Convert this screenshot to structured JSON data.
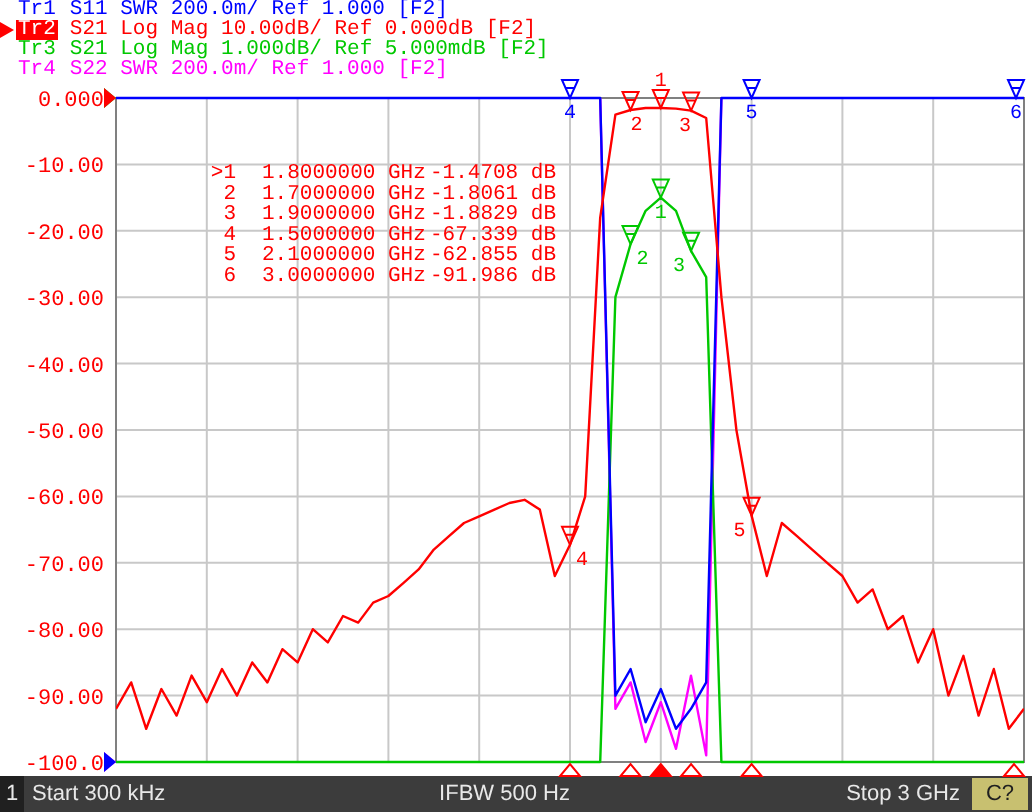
{
  "traces": [
    {
      "label": "Tr1",
      "kind": "swr",
      "markers": [
        {
          "shown": false
        },
        {
          "shown": false
        },
        {
          "shown": false
        },
        {
          "label": "4",
          "shown": true
        },
        {
          "label": "5",
          "shown": true
        },
        {
          "label": "6",
          "shown": true
        }
      ],
      "text": "S11 SWR 200.0m/ Ref 1.000 [F2]",
      "color": "#0000ff",
      "selected": false
    },
    {
      "label": "Tr2",
      "kind": "logmag",
      "markers": [
        {
          "label": "1",
          "shown": true
        },
        {
          "label": "2",
          "shown": true
        },
        {
          "label": "3",
          "shown": true
        },
        {
          "label": "4",
          "shown": true
        },
        {
          "label": "5",
          "shown": true
        },
        {
          "shown": false
        }
      ],
      "text": "S21 Log Mag 10.00dB/ Ref 0.000dB [F2]",
      "color": "#ff0000",
      "selected": true
    },
    {
      "label": "Tr3",
      "kind": "logmag",
      "markers": [
        {
          "label": "1",
          "shown": true
        },
        {
          "label": "2",
          "shown": true
        },
        {
          "label": "3",
          "shown": true
        }
      ],
      "text": "S21 Log Mag 1.000dB/ Ref 5.000mdB [F2]",
      "color": "#00c800",
      "selected": false
    },
    {
      "label": "Tr4",
      "kind": "swr",
      "text": "S22 SWR 200.0m/ Ref 1.000 [F2]",
      "color": "#ff00ff",
      "selected": false
    }
  ],
  "marker_table": [
    {
      "marker": ">1",
      "frequency": "1.8000000 GHz",
      "value": "-1.4708 dB",
      "selected": true
    },
    {
      "marker": "2",
      "frequency": "1.7000000 GHz",
      "value": "-1.8061 dB",
      "selected": false
    },
    {
      "marker": "3",
      "frequency": "1.9000000 GHz",
      "value": "-1.8829 dB",
      "selected": false
    },
    {
      "marker": "4",
      "frequency": "1.5000000 GHz",
      "value": "-67.339 dB",
      "selected": false
    },
    {
      "marker": "5",
      "frequency": "2.1000000 GHz",
      "value": "-62.855 dB",
      "selected": false
    },
    {
      "marker": "6",
      "frequency": "3.0000000 GHz",
      "value": "-91.986 dB",
      "selected": false
    }
  ],
  "chart_data": {
    "type": "line",
    "grid": true,
    "ylim": [
      -100,
      0
    ],
    "yticks": [
      {
        "value": 0,
        "label": "0.000"
      },
      {
        "value": -10,
        "label": "-10.00"
      },
      {
        "value": -20,
        "label": "-20.00"
      },
      {
        "value": -30,
        "label": "-30.00"
      },
      {
        "value": -40,
        "label": "-40.00"
      },
      {
        "value": -50,
        "label": "-50.00"
      },
      {
        "value": -60,
        "label": "-60.00"
      },
      {
        "value": -70,
        "label": "-70.00"
      },
      {
        "value": -80,
        "label": "-80.00"
      },
      {
        "value": -90,
        "label": "-90.00"
      },
      {
        "value": -100,
        "label": "-100.0"
      }
    ],
    "categories": [
      null,
      null,
      null,
      null,
      null,
      null,
      null,
      null,
      null,
      null,
      null,
      null,
      null,
      null,
      null,
      null,
      null,
      null,
      null,
      null,
      null,
      null,
      null,
      null,
      null,
      null,
      null,
      null,
      null,
      null,
      null,
      null,
      null,
      null,
      null,
      null,
      null,
      null,
      null,
      null,
      null,
      null,
      null,
      null,
      null,
      null,
      null,
      null,
      null,
      null,
      null,
      null,
      null,
      null,
      null,
      null,
      null,
      null,
      null,
      null,
      null
    ],
    "series": [
      {
        "color": "#0000ff",
        "values": [
          0,
          0,
          0,
          0,
          0,
          0,
          0,
          0,
          0,
          0,
          0,
          0,
          0,
          0,
          0,
          0,
          0,
          0,
          0,
          0,
          0,
          0,
          0,
          0,
          0,
          0,
          0,
          0,
          0,
          0,
          0,
          0,
          0,
          -90,
          -86,
          -94,
          -89,
          -95,
          -92,
          -88,
          0,
          0,
          0,
          0,
          0,
          0,
          0,
          0,
          0,
          0,
          0,
          0,
          0,
          0,
          0,
          0,
          0,
          0,
          0,
          0,
          0
        ]
      },
      {
        "color": "#ff0000",
        "values": [
          -92,
          -88,
          -95,
          -89,
          -93,
          -87,
          -91,
          -86,
          -90,
          -85,
          -88,
          -83,
          -85,
          -80,
          -82,
          -78,
          -79,
          -76,
          -75,
          -73,
          -71,
          -68,
          -66,
          -64,
          -63,
          -62,
          -61,
          -60.5,
          -62,
          -72,
          -67.3,
          -60,
          -18,
          -2.5,
          -1.8,
          -1.5,
          -1.5,
          -1.6,
          -1.9,
          -3,
          -30,
          -50,
          -62.9,
          -72,
          -64,
          -66,
          -68,
          -70,
          -72,
          -76,
          -74,
          -80,
          -78,
          -85,
          -80,
          -90,
          -84,
          -93,
          -86,
          -95,
          -92
        ]
      },
      {
        "color": "#00c800",
        "values": [
          -100,
          -100,
          -100,
          -100,
          -100,
          -100,
          -100,
          -100,
          -100,
          -100,
          -100,
          -100,
          -100,
          -100,
          -100,
          -100,
          -100,
          -100,
          -100,
          -100,
          -100,
          -100,
          -100,
          -100,
          -100,
          -100,
          -100,
          -100,
          -100,
          -100,
          -100,
          -100,
          -100,
          -30,
          -22,
          -17,
          -15,
          -17,
          -23,
          -27,
          -100,
          -100,
          -100,
          -100,
          -100,
          -100,
          -100,
          -100,
          -100,
          -100,
          -100,
          -100,
          -100,
          -100,
          -100,
          -100,
          -100,
          -100,
          -100,
          -100,
          -100
        ]
      },
      {
        "color": "#ff00ff",
        "values": [
          null,
          null,
          null,
          null,
          null,
          null,
          null,
          null,
          null,
          null,
          null,
          null,
          null,
          null,
          null,
          null,
          null,
          null,
          null,
          null,
          null,
          null,
          null,
          null,
          null,
          null,
          null,
          null,
          null,
          null,
          null,
          null,
          0,
          -92,
          -88,
          -97,
          -91,
          -98,
          -87,
          -99,
          0,
          null,
          null,
          null,
          null,
          null,
          null,
          null,
          null,
          null,
          null,
          null,
          null,
          null,
          null,
          null,
          null,
          null,
          null,
          null,
          null
        ]
      }
    ]
  },
  "status_bar": {
    "channel": "1",
    "start": "Start 300 kHz",
    "ifbw": "IFBW 500 Hz",
    "stop": "Stop 3 GHz",
    "badge": "C?"
  }
}
